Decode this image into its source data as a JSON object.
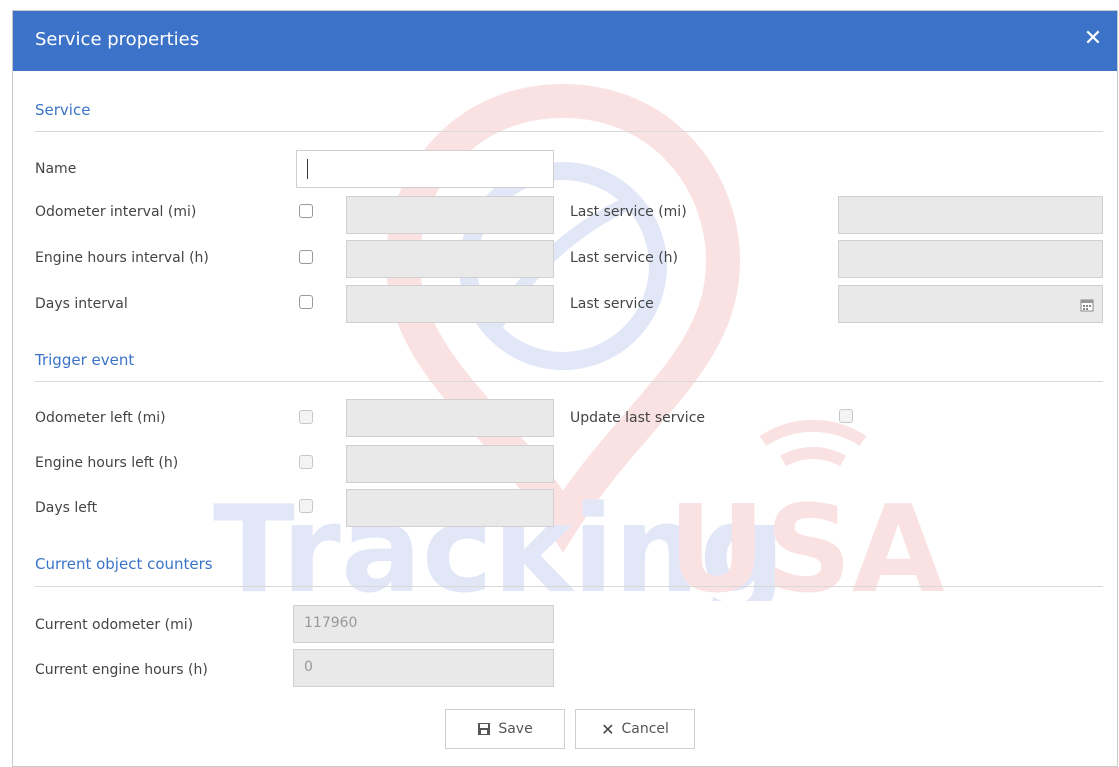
{
  "dialog": {
    "title": "Service properties",
    "close_symbol": "✕"
  },
  "sections": {
    "service": "Service",
    "trigger": "Trigger event",
    "counters": "Current object counters"
  },
  "service": {
    "name_label": "Name",
    "name_value": "",
    "odometer_interval_label": "Odometer interval (mi)",
    "engine_hours_interval_label": "Engine hours interval (h)",
    "days_interval_label": "Days interval",
    "last_service_mi_label": "Last service (mi)",
    "last_service_h_label": "Last service (h)",
    "last_service_label": "Last service"
  },
  "trigger": {
    "odometer_left_label": "Odometer left (mi)",
    "engine_hours_left_label": "Engine hours left (h)",
    "days_left_label": "Days left",
    "update_last_service_label": "Update last service"
  },
  "counters": {
    "current_odometer_label": "Current odometer (mi)",
    "current_odometer_value": "117960",
    "current_engine_hours_label": "Current engine hours (h)",
    "current_engine_hours_value": "0"
  },
  "buttons": {
    "save": "Save",
    "cancel": "Cancel"
  },
  "watermark": {
    "text_left": "Tracking",
    "text_right": "USA"
  },
  "colors": {
    "titlebar": "#3c73c9",
    "section": "#3b73c8",
    "watermark_blue": "#3b5fd1",
    "watermark_red": "#e23b3b"
  },
  "icons": {
    "close": "close-icon",
    "calendar": "calendar-icon",
    "save": "floppy-disk-icon",
    "cancel": "x-icon"
  }
}
